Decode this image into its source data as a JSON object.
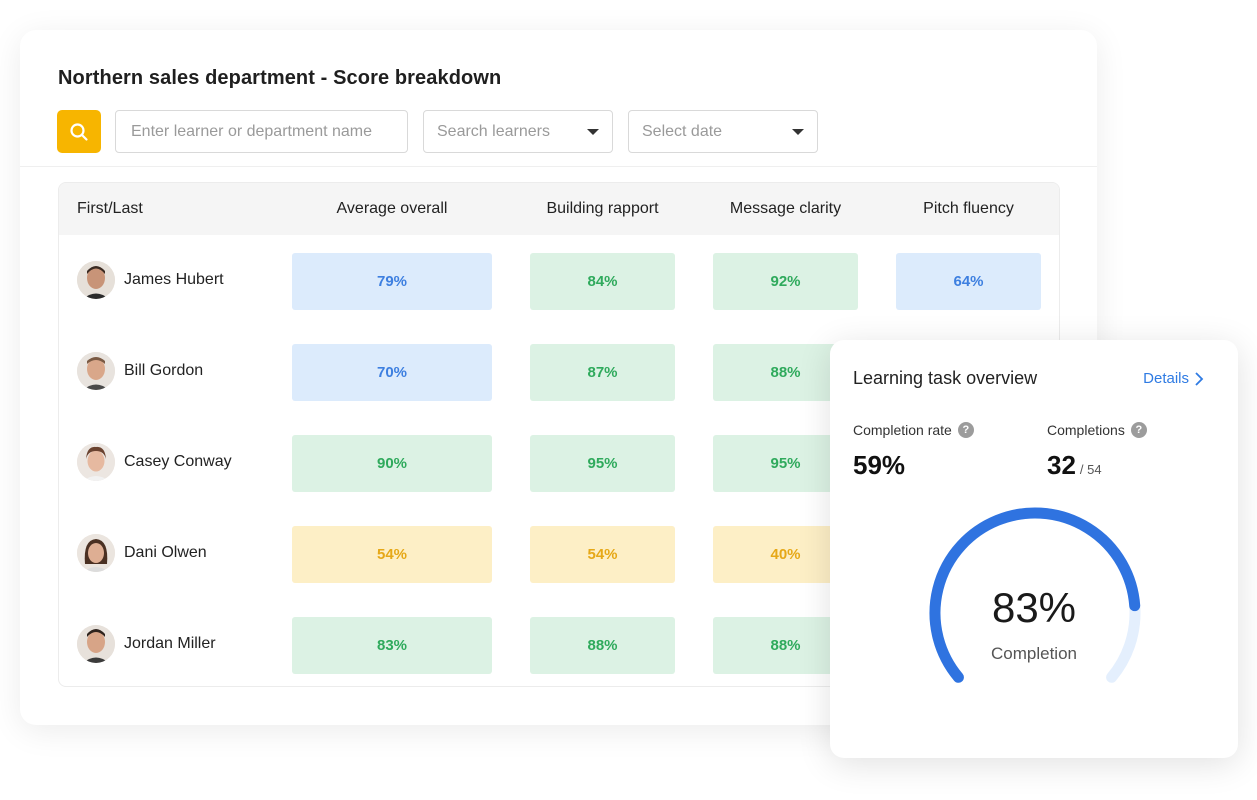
{
  "header": {
    "title": "Northern sales department - Score breakdown"
  },
  "toolbar": {
    "search_placeholder": "Enter learner or department name",
    "learners_select": "Search learners",
    "date_select": "Select date"
  },
  "table": {
    "columns": [
      "First/Last",
      "Average overall",
      "Building rapport",
      "Message clarity",
      "Pitch fluency"
    ],
    "rows": [
      {
        "name": "James Hubert",
        "scores": [
          "79%",
          "84%",
          "92%",
          "64%"
        ]
      },
      {
        "name": "Bill Gordon",
        "scores": [
          "70%",
          "87%",
          "88%",
          ""
        ]
      },
      {
        "name": "Casey Conway",
        "scores": [
          "90%",
          "95%",
          "95%",
          ""
        ]
      },
      {
        "name": "Dani Olwen",
        "scores": [
          "54%",
          "54%",
          "40%",
          ""
        ]
      },
      {
        "name": "Jordan Miller",
        "scores": [
          "83%",
          "88%",
          "88%",
          ""
        ]
      }
    ]
  },
  "overview": {
    "title": "Learning task overview",
    "details_label": "Details",
    "completion_rate_label": "Completion rate",
    "completion_rate_value": "59%",
    "completions_label": "Completions",
    "completions_value": "32",
    "completions_total": "/ 54",
    "gauge_percent": "83%",
    "gauge_fraction": 0.83,
    "gauge_label": "Completion"
  },
  "colors": {
    "accent_yellow": "#f7b500",
    "link_blue": "#2f7be3",
    "gauge_blue": "#2f73e0",
    "gauge_track": "#e4effd",
    "score_blue_bg": "#dcebfc",
    "score_green_bg": "#dcf2e4",
    "score_yellow_bg": "#fdefc6"
  },
  "icons": {
    "search": "search-icon",
    "dropdown": "caret-down-icon",
    "details": "chevron-right-icon",
    "help": "question-circle-icon"
  }
}
